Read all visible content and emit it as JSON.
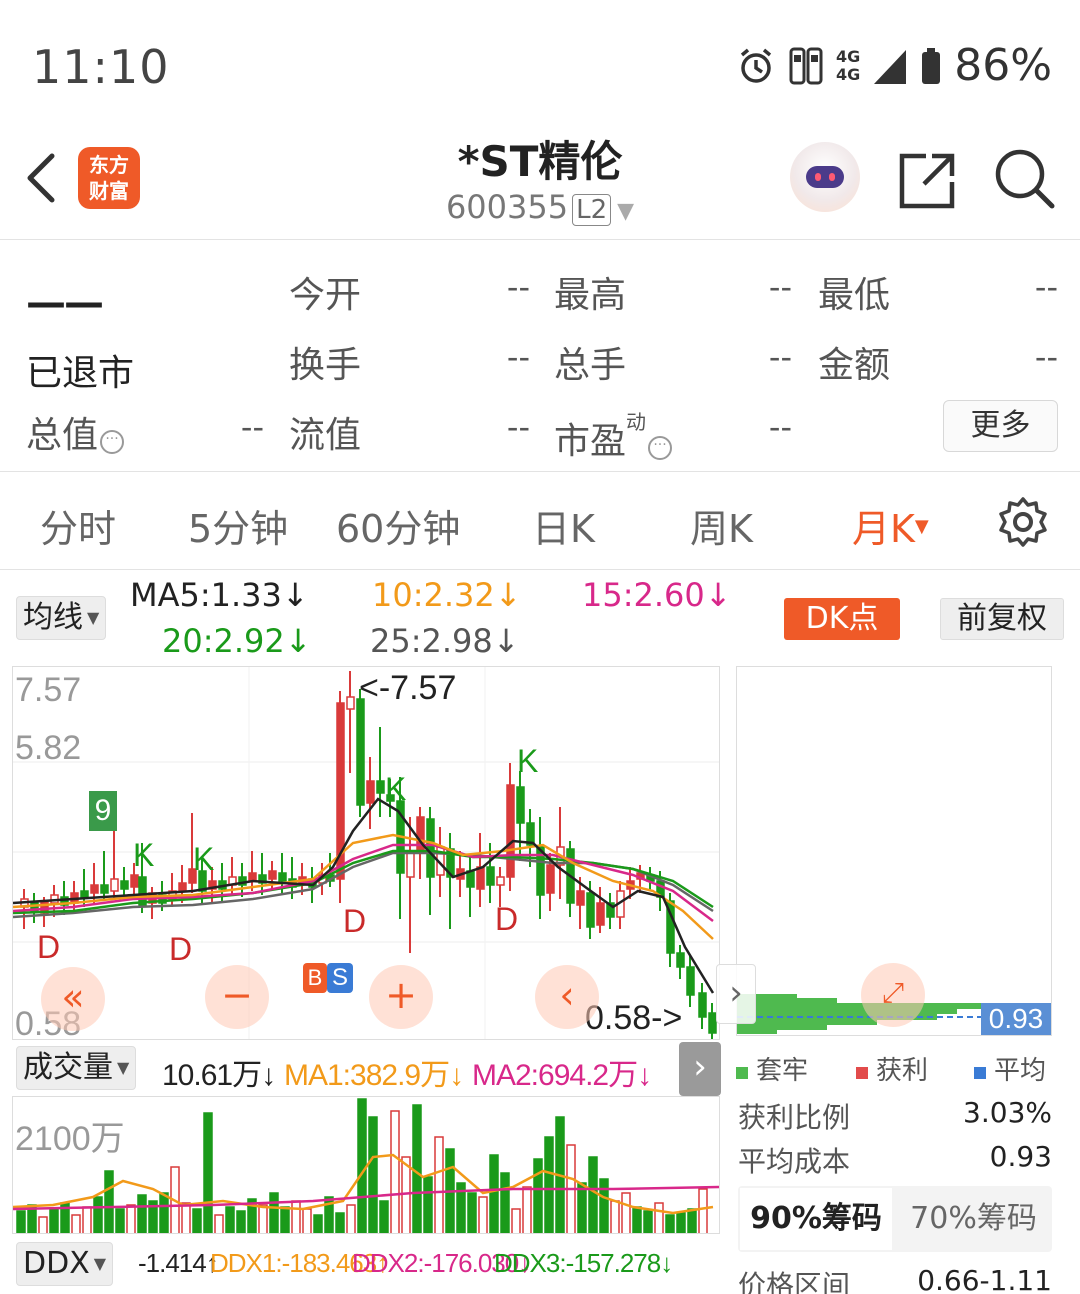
{
  "status_bar": {
    "time": "11:10",
    "net_top": "4G",
    "net_bottom": "4G",
    "battery": "86%"
  },
  "header": {
    "logo_line1": "东方",
    "logo_line2": "财富",
    "title": "*ST精伦",
    "code": "600355",
    "badge": "L2"
  },
  "quote": {
    "price": "——",
    "state": "已退市",
    "fields": [
      {
        "label": "今开",
        "value": "--"
      },
      {
        "label": "最高",
        "value": "--"
      },
      {
        "label": "最低",
        "value": "--"
      },
      {
        "label": "换手",
        "value": "--"
      },
      {
        "label": "总手",
        "value": "--"
      },
      {
        "label": "金额",
        "value": "--"
      },
      {
        "label": "总值",
        "value": "--"
      },
      {
        "label": "流值",
        "value": "--"
      },
      {
        "label": "市盈",
        "value": "--"
      }
    ],
    "pe_sup": "动",
    "more": "更多"
  },
  "tabs": [
    "分时",
    "5分钟",
    "60分钟",
    "日K",
    "周K",
    "月K"
  ],
  "active_tab": "月K",
  "ma_legend": {
    "selector": "均线",
    "ma5": "MA5:1.33↓",
    "ma10": "10:2.32↓",
    "ma15": "15:2.60↓",
    "ma20": "20:2.92↓",
    "ma25": "25:2.98↓",
    "dk": "DK点",
    "adjust": "前复权"
  },
  "kchart": {
    "y_high": "7.57",
    "y_mid": "5.82",
    "y_low": "0.58",
    "max_label": "<-7.57",
    "min_label": "0.58->",
    "marker_9": "9",
    "marker_k": "K",
    "marker_d": "D",
    "marker_s": "S",
    "marker_b": "B",
    "colors": {
      "up": "#d93a3a",
      "down": "#1a9a1a",
      "ma5": "#222222",
      "ma10": "#f29a1a",
      "ma15": "#d8288a",
      "ma20": "#1a9a1a",
      "ma25": "#666666"
    }
  },
  "chips": {
    "price_tag": "0.93",
    "legend": [
      "套牢",
      "获利",
      "平均"
    ],
    "profit_ratio_label": "获利比例",
    "profit_ratio": "3.03%",
    "avg_cost_label": "平均成本",
    "avg_cost": "0.93",
    "tab_90": "90%筹码",
    "tab_70": "70%筹码",
    "range_label": "价格区间",
    "range": "0.66-1.11"
  },
  "volume": {
    "selector": "成交量",
    "vol": "10.61万↓",
    "ma1": "MA1:382.9万↓",
    "ma2": "MA2:694.2万↓",
    "y_max": "2100万"
  },
  "ddx": {
    "selector": "DDX",
    "v0": "-1.414↑",
    "v1": "DDX1:-183.463↑",
    "v2": "DDX2:-176.030↓",
    "v3": "DDX3:-157.278↓"
  }
}
